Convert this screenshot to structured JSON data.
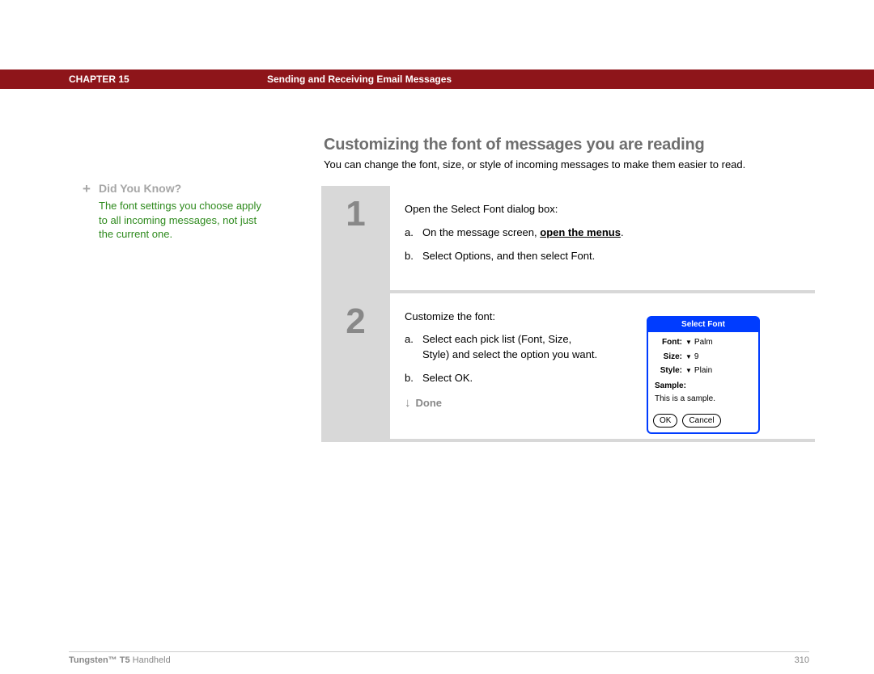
{
  "header": {
    "chapter": "CHAPTER 15",
    "title": "Sending and Receiving Email Messages"
  },
  "section": {
    "title": "Customizing the font of messages you are reading",
    "intro": "You can change the font, size, or style of incoming messages to make them easier to read."
  },
  "sidebar": {
    "label": "Did You Know?",
    "plus": "+",
    "body": "The font settings you choose apply to all incoming messages, not just the current one."
  },
  "steps": [
    {
      "num": "1",
      "lead": "Open the Select Font dialog box:",
      "items": [
        {
          "letter": "a.",
          "pre": "On the message screen, ",
          "link": "open the menus",
          "post": "."
        },
        {
          "letter": "b.",
          "pre": "Select Options, and then select Font.",
          "link": "",
          "post": ""
        }
      ]
    },
    {
      "num": "2",
      "lead": "Customize the font:",
      "items": [
        {
          "letter": "a.",
          "pre": "Select each pick list (Font, Size, Style) and select the option you want.",
          "link": "",
          "post": ""
        },
        {
          "letter": "b.",
          "pre": "Select OK.",
          "link": "",
          "post": ""
        }
      ],
      "done": "Done"
    }
  ],
  "dialog": {
    "title": "Select Font",
    "rows": {
      "font": {
        "label": "Font:",
        "value": "Palm"
      },
      "size": {
        "label": "Size:",
        "value": "9"
      },
      "style": {
        "label": "Style:",
        "value": "Plain"
      }
    },
    "sample_label": "Sample:",
    "sample_text": "This is a sample.",
    "ok": "OK",
    "cancel": "Cancel"
  },
  "footer": {
    "product_bold": "Tungsten™ T5",
    "product_rest": " Handheld",
    "page": "310"
  }
}
